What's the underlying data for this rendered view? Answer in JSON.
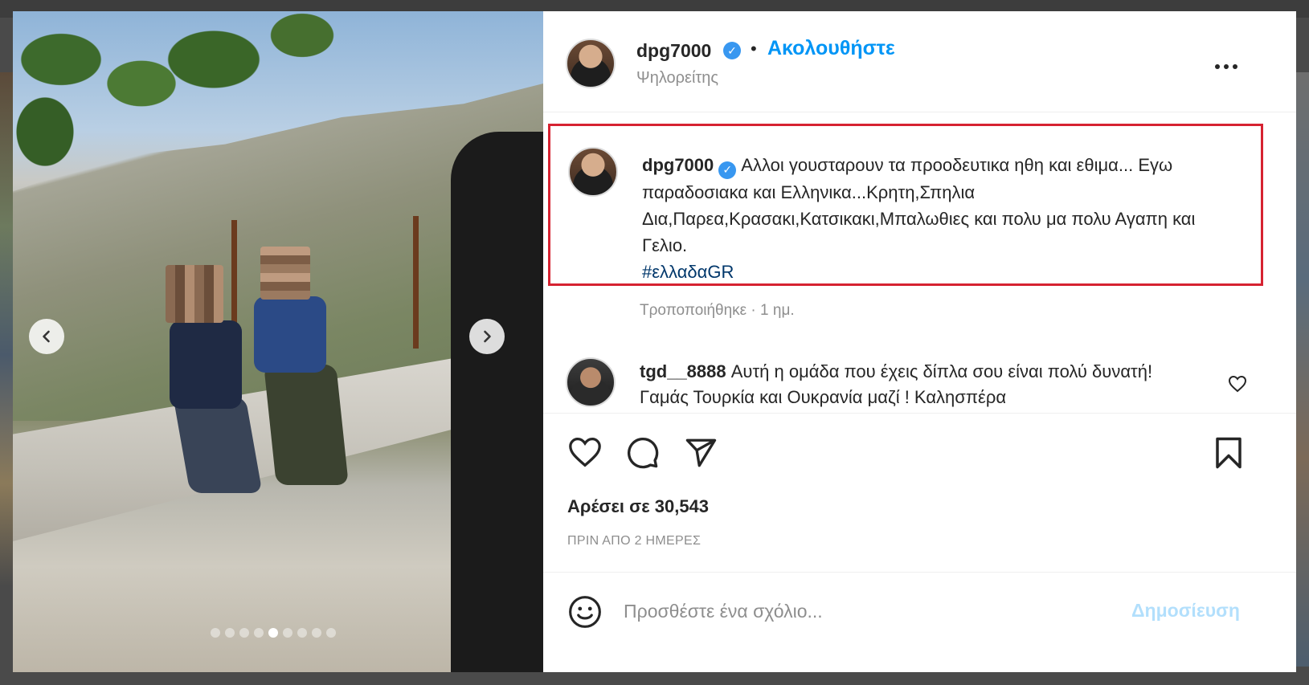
{
  "post": {
    "username": "dpg7000",
    "follow_label": "Ακολουθήστε",
    "separator": "•",
    "location": "Ψηλορείτης",
    "more_icon": "more-options-icon"
  },
  "caption": {
    "username": "dpg7000",
    "text": "Αλλοι γουσταρουν τα προοδευτικα ηθη και εθιμα... Εγω παραδοσιακα και Ελληνικα...Κρητη,Σπηλια Δια,Παρεα,Κρασακι,Κατσικακι,Μπαλωθιες και πολυ μα πολυ Αγαπη και Γελιο.",
    "hashtag": "#ελλαδαGR",
    "edited": "Τροποποιήθηκε · 1 ημ.",
    "highlight_color": "#d62231"
  },
  "comments": [
    {
      "username": "tgd__8888",
      "text": "Αυτή η ομάδα που έχεις δίπλα σου είναι πολύ δυνατή! Γαμάς Τουρκία και Ουκρανία μαζί ! Καλησπέρα"
    }
  ],
  "actions": {
    "like_icon": "heart-icon",
    "comment_icon": "comment-icon",
    "share_icon": "send-icon",
    "save_icon": "bookmark-icon"
  },
  "stats": {
    "likes": "Αρέσει σε 30,543",
    "timestamp": "ΠΡΙΝ ΑΠΟ 2 ΗΜΕΡΕΣ"
  },
  "comment_box": {
    "placeholder": "Προσθέστε ένα σχόλιο...",
    "post_label": "Δημοσίευση"
  },
  "carousel": {
    "total_slides": 9,
    "active_slide": 5
  },
  "colors": {
    "link_blue": "#0095f6",
    "verified_blue": "#3897f0",
    "post_disabled": "#b2dffc",
    "hashtag": "#00376b"
  }
}
